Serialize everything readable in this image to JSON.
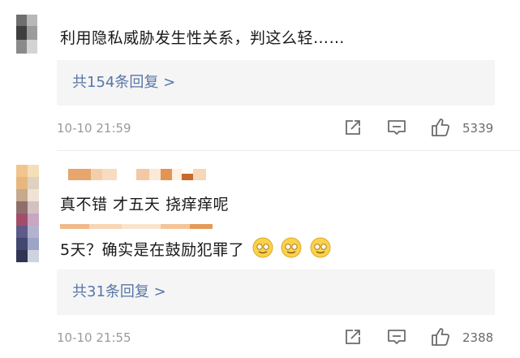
{
  "comments": [
    {
      "text": "利用隐私威胁发生性关系，判这么轻……",
      "reply_label": "共154条回复 >",
      "timestamp": "10-10 21:59",
      "like_count": "5339"
    },
    {
      "line1": "真不错 才五天 挠痒痒呢",
      "line2": "5天？确实是在鼓励犯罪了",
      "reply_label": "共31条回复 >",
      "timestamp": "10-10 21:55",
      "like_count": "2388"
    }
  ],
  "icons": {
    "share": "share-icon",
    "comment": "comment-icon",
    "like": "thumbs-up-icon",
    "emoji": "smirk-face-emoji"
  },
  "colors": {
    "link": "#5676a8",
    "reply_bg": "#f5f5f5",
    "muted": "#9a9a9a"
  }
}
